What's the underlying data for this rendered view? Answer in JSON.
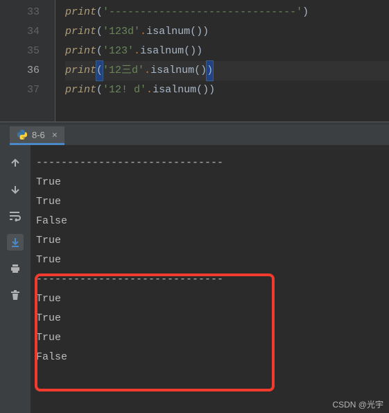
{
  "editor": {
    "lines": [
      {
        "num": 33,
        "fn": "print",
        "args": [
          {
            "t": "str",
            "v": "'------------------------------'"
          }
        ]
      },
      {
        "num": 34,
        "fn": "print",
        "args": [
          {
            "t": "str",
            "v": "'123d'"
          },
          {
            "t": "op",
            "v": "."
          },
          {
            "t": "plain",
            "v": "isalnum"
          },
          {
            "t": "par",
            "v": "()"
          }
        ]
      },
      {
        "num": 35,
        "fn": "print",
        "args": [
          {
            "t": "str",
            "v": "'123'"
          },
          {
            "t": "op",
            "v": "."
          },
          {
            "t": "plain",
            "v": "isalnum"
          },
          {
            "t": "par",
            "v": "()"
          }
        ]
      },
      {
        "num": 36,
        "fn": "print",
        "args": [
          {
            "t": "str",
            "v": "'12三d'"
          },
          {
            "t": "op",
            "v": "."
          },
          {
            "t": "plain",
            "v": "isalnum"
          },
          {
            "t": "par",
            "v": "()"
          }
        ],
        "active": true
      },
      {
        "num": 37,
        "fn": "print",
        "args": [
          {
            "t": "str",
            "v": "'12! d'"
          },
          {
            "t": "op",
            "v": "."
          },
          {
            "t": "plain",
            "v": "isalnum"
          },
          {
            "t": "par",
            "v": "()"
          }
        ]
      }
    ]
  },
  "tab": {
    "label": "8-6"
  },
  "console": {
    "lines": [
      "------------------------------",
      "True",
      "True",
      "False",
      "True",
      "True",
      "------------------------------",
      "True",
      "True",
      "True",
      "False"
    ]
  },
  "watermark": "CSDN @光宇",
  "icons": {
    "up": "up-arrow-icon",
    "down": "down-arrow-icon",
    "wrap": "soft-wrap-icon",
    "scroll": "scroll-to-end-icon",
    "print": "print-icon",
    "trash": "trash-icon"
  }
}
